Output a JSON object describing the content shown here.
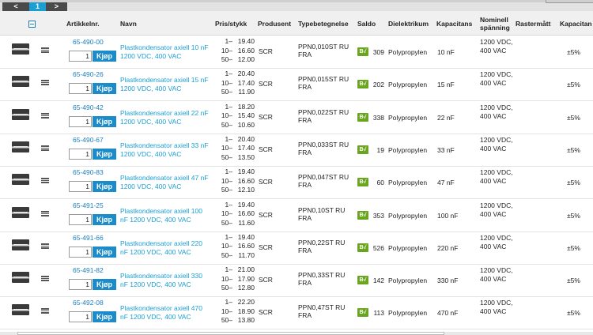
{
  "pager": {
    "prev": "<",
    "current": "1",
    "next": ">"
  },
  "headers": {
    "article": "Artikkelnr.",
    "name": "Navn",
    "price": "Pris/stykk",
    "producer": "Produsent",
    "type": "Typebetegnelse",
    "stock": "Saldo",
    "dielectric": "Dielektrikum",
    "capacitance": "Kapacitans",
    "nominal_voltage": "Nominell spänning",
    "pitch": "Rastermått",
    "cap_tolerance": "Kapacitan"
  },
  "buy_label": "Kjøp",
  "stock_icon_text": "B√",
  "rows": [
    {
      "art": "65-490-00",
      "qty": "1",
      "name": "Plastkondensator axiell 10 nF 1200 VDC, 400 VAC",
      "p1": "19.40",
      "p2": "16.60",
      "p3": "12.00",
      "producer": "SCR",
      "type": "PPN0,010ST RU FRA",
      "stock": "309",
      "dielectric": "Polypropylen",
      "cap": "10 nF",
      "volt": "1200 VDC, 400 VAC",
      "tol": "±5%"
    },
    {
      "art": "65-490-26",
      "qty": "1",
      "name": "Plastkondensator axiell 15 nF 1200 VDC, 400 VAC",
      "p1": "20.40",
      "p2": "17.40",
      "p3": "11.90",
      "producer": "SCR",
      "type": "PPN0,015ST RU FRA",
      "stock": "202",
      "dielectric": "Polypropylen",
      "cap": "15 nF",
      "volt": "1200 VDC, 400 VAC",
      "tol": "±5%"
    },
    {
      "art": "65-490-42",
      "qty": "1",
      "name": "Plastkondensator axiell 22 nF 1200 VDC, 400 VAC",
      "p1": "18.20",
      "p2": "15.40",
      "p3": "10.60",
      "producer": "SCR",
      "type": "PPN0,022ST RU FRA",
      "stock": "338",
      "dielectric": "Polypropylen",
      "cap": "22 nF",
      "volt": "1200 VDC, 400 VAC",
      "tol": "±5%"
    },
    {
      "art": "65-490-67",
      "qty": "1",
      "name": "Plastkondensator axiell 33 nF 1200 VDC, 400 VAC",
      "p1": "20.40",
      "p2": "17.40",
      "p3": "13.50",
      "producer": "SCR",
      "type": "PPN0,033ST RU FRA",
      "stock": "19",
      "dielectric": "Polypropylen",
      "cap": "33 nF",
      "volt": "1200 VDC, 400 VAC",
      "tol": "±5%"
    },
    {
      "art": "65-490-83",
      "qty": "1",
      "name": "Plastkondensator axiell 47 nF 1200 VDC, 400 VAC",
      "p1": "19.40",
      "p2": "16.60",
      "p3": "12.10",
      "producer": "SCR",
      "type": "PPN0,047ST RU FRA",
      "stock": "60",
      "dielectric": "Polypropylen",
      "cap": "47 nF",
      "volt": "1200 VDC, 400 VAC",
      "tol": "±5%"
    },
    {
      "art": "65-491-25",
      "qty": "1",
      "name": "Plastkondensator axiell 100 nF 1200 VDC, 400 VAC",
      "p1": "19.40",
      "p2": "16.60",
      "p3": "11.60",
      "producer": "SCR",
      "type": "PPN0,10ST RU FRA",
      "stock": "353",
      "dielectric": "Polypropylen",
      "cap": "100 nF",
      "volt": "1200 VDC, 400 VAC",
      "tol": "±5%"
    },
    {
      "art": "65-491-66",
      "qty": "1",
      "name": "Plastkondensator axiell 220 nF 1200 VDC, 400 VAC",
      "p1": "19.40",
      "p2": "16.60",
      "p3": "11.70",
      "producer": "SCR",
      "type": "PPN0,22ST RU FRA",
      "stock": "526",
      "dielectric": "Polypropylen",
      "cap": "220 nF",
      "volt": "1200 VDC, 400 VAC",
      "tol": "±5%"
    },
    {
      "art": "65-491-82",
      "qty": "1",
      "name": "Plastkondensator axiell 330 nF 1200 VDC, 400 VAC",
      "p1": "21.00",
      "p2": "17.90",
      "p3": "12.80",
      "producer": "SCR",
      "type": "PPN0,33ST RU FRA",
      "stock": "142",
      "dielectric": "Polypropylen",
      "cap": "330 nF",
      "volt": "1200 VDC, 400 VAC",
      "tol": "±5%"
    },
    {
      "art": "65-492-08",
      "qty": "1",
      "name": "Plastkondensator axiell 470 nF 1200 VDC, 400 VAC",
      "p1": "22.20",
      "p2": "18.90",
      "p3": "13.80",
      "producer": "SCR",
      "type": "PPN0,47ST RU FRA",
      "stock": "113",
      "dielectric": "Polypropylen",
      "cap": "470 nF",
      "volt": "1200 VDC, 400 VAC",
      "tol": "±5%"
    }
  ],
  "price_qty": {
    "q1": "1–",
    "q2": "10–",
    "q3": "50–"
  }
}
